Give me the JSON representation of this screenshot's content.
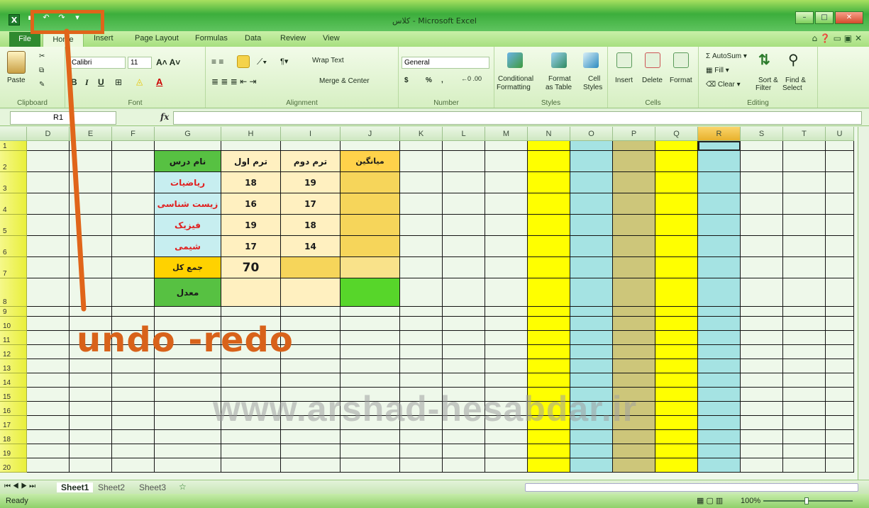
{
  "window": {
    "title": "کلاس - Microsoft Excel"
  },
  "qat": {
    "undo": "↶",
    "redo": "↷",
    "more": "▾"
  },
  "tabs": [
    {
      "label": "File"
    },
    {
      "label": "Home"
    },
    {
      "label": "Insert"
    },
    {
      "label": "Page Layout"
    },
    {
      "label": "Formulas"
    },
    {
      "label": "Data"
    },
    {
      "label": "Review"
    },
    {
      "label": "View"
    }
  ],
  "ribbon": {
    "clipboard": {
      "paste": "Paste",
      "label": "Clipboard"
    },
    "font": {
      "name": "Calibri",
      "size": "11",
      "bold": "B",
      "italic": "I",
      "underline": "U",
      "label": "Font"
    },
    "alignment": {
      "wrap": "Wrap Text",
      "merge": "Merge & Center",
      "label": "Alignment"
    },
    "number": {
      "format": "General",
      "currency": "$",
      "percent": "%",
      "comma": ",",
      "label": "Number"
    },
    "styles": {
      "conditional": "Conditional",
      "conditional2": "Formatting",
      "format_table": "Format",
      "format_table2": "as Table",
      "cell_styles": "Cell",
      "cell_styles2": "Styles",
      "label": "Styles"
    },
    "cells": {
      "insert": "Insert",
      "delete": "Delete",
      "format": "Format",
      "label": "Cells"
    },
    "editing": {
      "autosum": "AutoSum",
      "fill": "Fill",
      "clear": "Clear",
      "sort": "Sort &",
      "sort2": "Filter",
      "find": "Find &",
      "find2": "Select",
      "label": "Editing"
    }
  },
  "formula_bar": {
    "name_box": "R1",
    "fx": "fx",
    "content": ""
  },
  "columns": [
    "D",
    "E",
    "F",
    "G",
    "H",
    "I",
    "J",
    "K",
    "L",
    "M",
    "N",
    "O",
    "P",
    "Q",
    "R",
    "S",
    "T",
    "U"
  ],
  "rows": [
    "1",
    "2",
    "3",
    "4",
    "5",
    "6",
    "7",
    "8",
    "9",
    "10",
    "11",
    "12",
    "13",
    "14",
    "15",
    "16",
    "17",
    "18",
    "19",
    "20"
  ],
  "table": {
    "headers": [
      "نام درس",
      "ترم اول",
      "ترم دوم",
      "میانگین"
    ],
    "rows": [
      {
        "subject": "ریاضیات",
        "t1": "18",
        "t2": "19"
      },
      {
        "subject": "زیست شناسی",
        "t1": "16",
        "t2": "17"
      },
      {
        "subject": "فیزیک",
        "t1": "19",
        "t2": "18"
      },
      {
        "subject": "شیمی",
        "t1": "17",
        "t2": "14"
      }
    ],
    "total_label": "جمع کل",
    "total_value": "70",
    "avg_label": "معدل"
  },
  "sheets": [
    "Sheet1",
    "Sheet2",
    "Sheet3"
  ],
  "status": {
    "ready": "Ready",
    "zoom": "100%"
  },
  "overlay": {
    "caption": "undo -redo",
    "watermark": "www.arshad-hesabdar.ir"
  },
  "colors": {
    "title_green": "#3cae3c",
    "accent_orange": "#e0651a",
    "header_green": "#57c142",
    "teal": "#a5e3e3",
    "yellow": "#ffff00",
    "khaki": "#cdc67a"
  }
}
